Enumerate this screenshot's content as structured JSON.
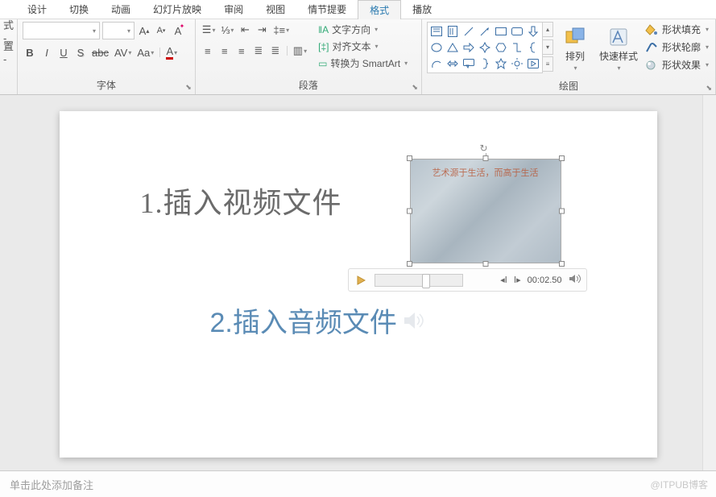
{
  "tabs": {
    "items": [
      "设计",
      "切换",
      "动画",
      "幻灯片放映",
      "审阅",
      "视图",
      "情节提要",
      "格式",
      "播放"
    ],
    "active_index": 7
  },
  "ribbon": {
    "left_group": {
      "line1": "式 -",
      "line2": "置 -"
    },
    "font": {
      "group_label": "字体",
      "bold": "B",
      "italic": "I",
      "underline": "U",
      "strike": "abc",
      "spacing": "AV",
      "case": "Aa",
      "clear": "A"
    },
    "paragraph": {
      "group_label": "段落",
      "text_direction": "文字方向",
      "align_text": "对齐文本",
      "convert_smartart": "转换为 SmartArt"
    },
    "drawing": {
      "group_label": "绘图",
      "arrange": "排列",
      "quick_styles": "快速样式",
      "shape_fill": "形状填充",
      "shape_outline": "形状轮廓",
      "shape_effects": "形状效果"
    }
  },
  "slide": {
    "title1": "1.插入视频文件",
    "title2": "2.插入音频文件",
    "video_caption": "艺术源于生活，而高于生活"
  },
  "media": {
    "time": "00:02.50"
  },
  "notes": {
    "placeholder": "单击此处添加备注"
  },
  "watermark": "@ITPUB博客"
}
